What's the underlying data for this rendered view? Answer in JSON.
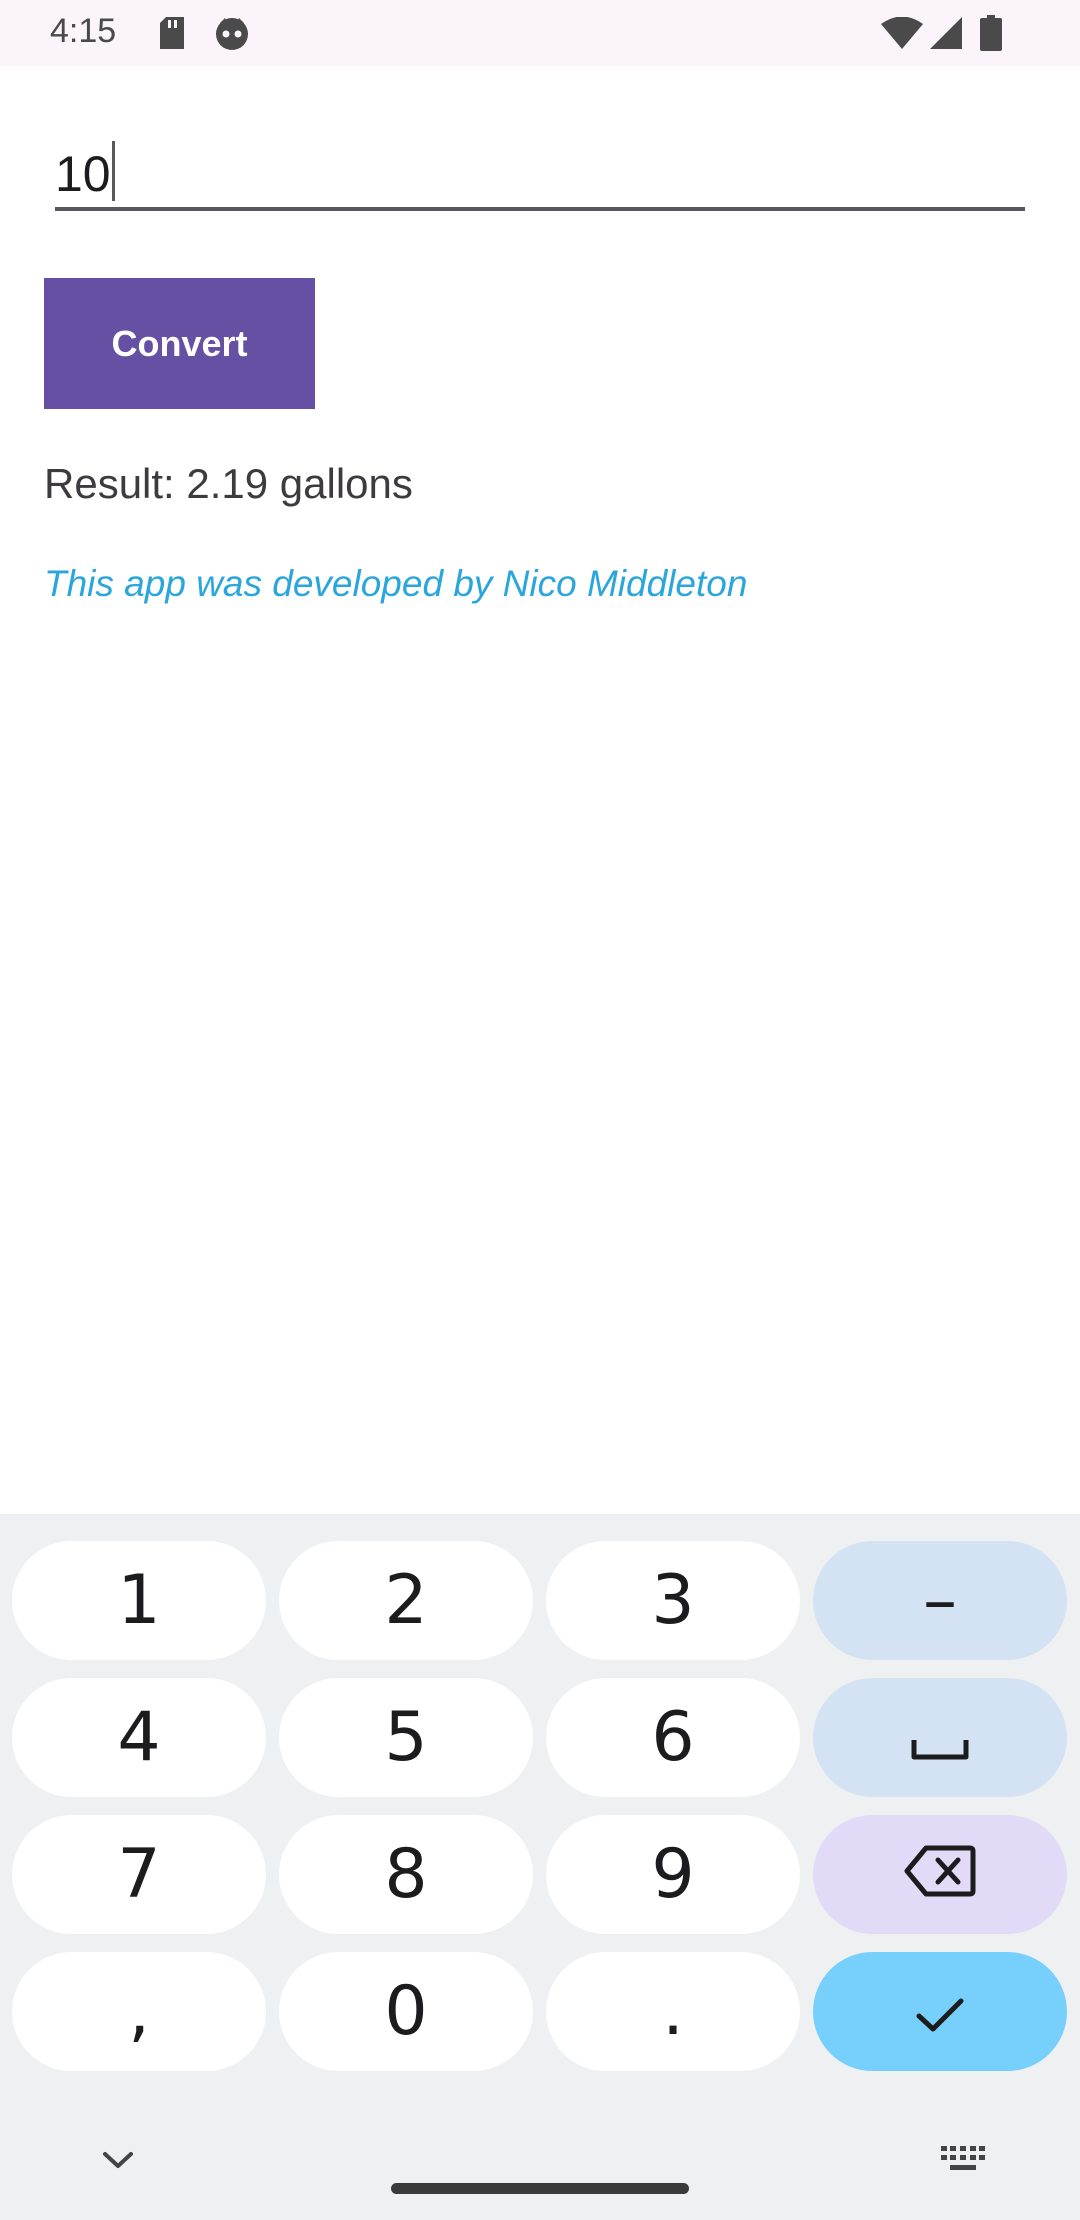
{
  "status_bar": {
    "time": "4:15",
    "icons": [
      "sd-card-icon",
      "face-icon",
      "wifi-icon",
      "cell-signal-icon",
      "battery-icon"
    ]
  },
  "converter": {
    "input_value": "10",
    "button_label": "Convert",
    "result": "Result: 2.19 gallons",
    "credit": "This app was developed by Nico Middleton"
  },
  "keyboard": {
    "keys": {
      "k1": "1",
      "k2": "2",
      "k3": "3",
      "minus": "–",
      "k4": "4",
      "k5": "5",
      "k6": "6",
      "k7": "7",
      "k8": "8",
      "k9": "9",
      "comma": ",",
      "k0": "0",
      "period": "."
    },
    "icons": [
      "space-icon",
      "backspace-icon",
      "check-icon",
      "chevron-down-icon",
      "keyboard-icon"
    ]
  },
  "colors": {
    "button": "#6650a4",
    "credit_text": "#2aa6dc",
    "enter_key": "#77d0fb",
    "function_key": "#d3e3f3",
    "delete_key": "#e1dbf7"
  }
}
